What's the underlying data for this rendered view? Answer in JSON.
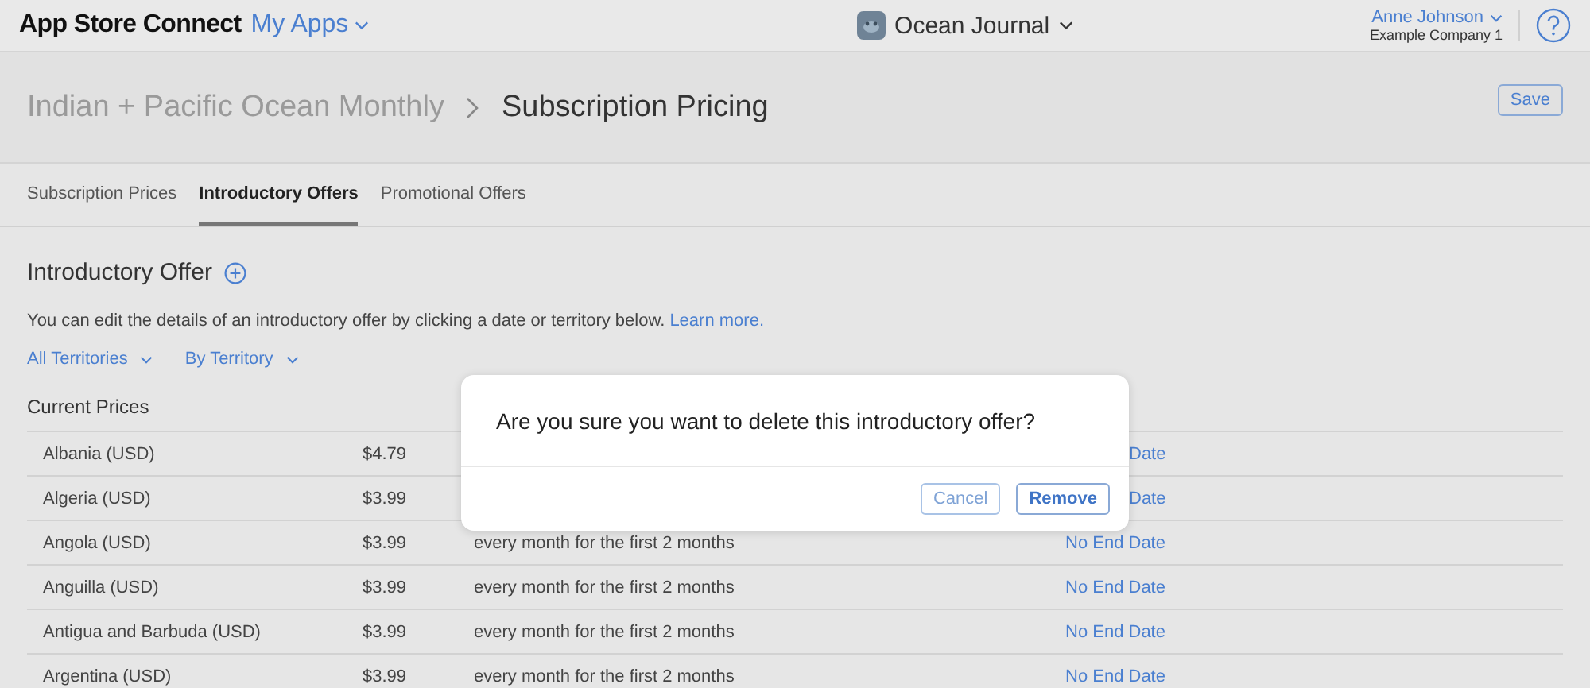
{
  "topbar": {
    "brand": "App Store Connect",
    "menu": "My Apps",
    "app_name": "Ocean Journal",
    "user_name": "Anne Johnson",
    "company": "Example Company 1"
  },
  "header": {
    "breadcrumb_parent": "Indian + Pacific Ocean Monthly",
    "breadcrumb_current": "Subscription Pricing",
    "save_button": "Save"
  },
  "tabs": [
    {
      "label": "Subscription Prices",
      "selected": false
    },
    {
      "label": "Introductory Offers",
      "selected": true
    },
    {
      "label": "Promotional Offers",
      "selected": false
    }
  ],
  "section": {
    "title": "Introductory Offer",
    "description": "You can edit the details of an introductory offer by clicking a date or territory below.",
    "link": "Learn more.",
    "filters": [
      "All Territories",
      "By Territory"
    ],
    "table_title": "Current Prices"
  },
  "rows": [
    {
      "territory": "Albania (USD)",
      "price": "$4.79",
      "end_date": "Date"
    },
    {
      "territory": "Algeria (USD)",
      "price": "$3.99",
      "end_date": "Date"
    },
    {
      "territory": "Angola (USD)",
      "price": "$3.99",
      "duration": "every month for the first 2 months",
      "end_date": "No End Date"
    },
    {
      "territory": "Anguilla (USD)",
      "price": "$3.99",
      "duration": "every month for the first 2 months",
      "end_date": "No End Date"
    },
    {
      "territory": "Antigua and Barbuda (USD)",
      "price": "$3.99",
      "duration": "every month for the first 2 months",
      "end_date": "No End Date"
    },
    {
      "territory": "Argentina (USD)",
      "price": "$3.99",
      "duration": "every month for the first 2 months",
      "end_date": "No End Date"
    }
  ],
  "dialog": {
    "message": "Are you sure you want to delete this introductory offer?",
    "buttons": [
      {
        "label": "Cancel",
        "kind": "secondary"
      },
      {
        "label": "Remove",
        "kind": "primary"
      }
    ]
  }
}
